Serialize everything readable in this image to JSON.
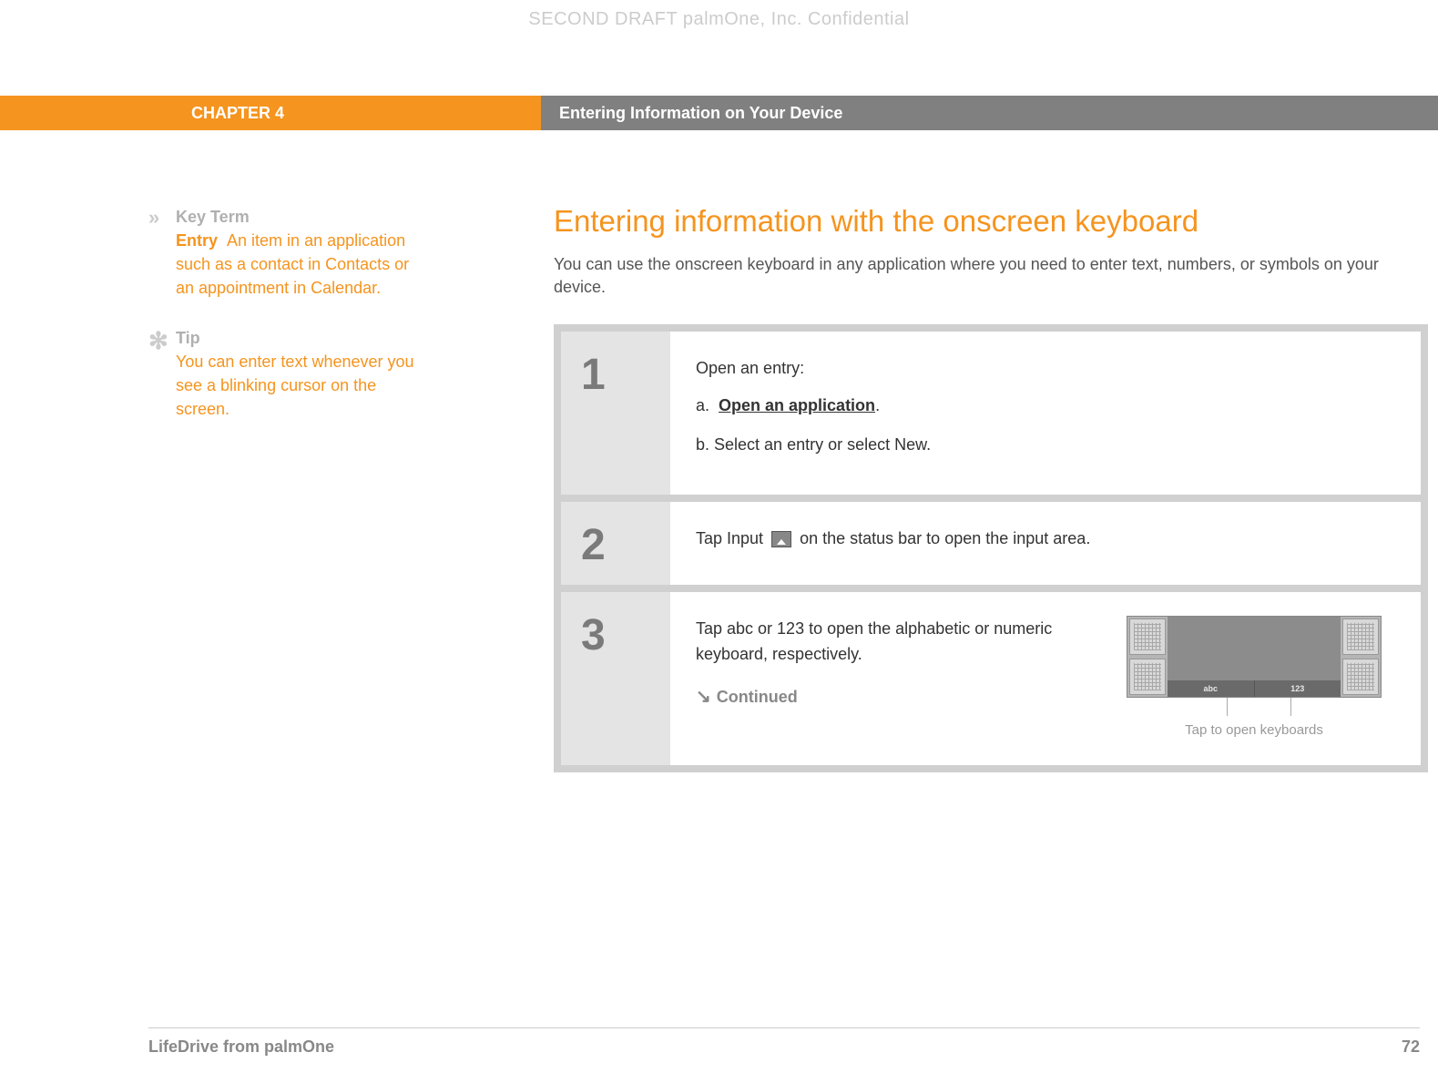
{
  "watermark": "SECOND DRAFT palmOne, Inc.  Confidential",
  "header": {
    "chapter": "CHAPTER 4",
    "section": "Entering Information on Your Device"
  },
  "sidebar": {
    "keyterm": {
      "heading": "Key Term",
      "term": "Entry",
      "definition": "An item in an application such as a contact in Contacts or an appointment in Calendar."
    },
    "tip": {
      "heading": "Tip",
      "text": "You can enter text whenever you see a blinking cursor on the screen."
    }
  },
  "main": {
    "title": "Entering information with the onscreen keyboard",
    "intro": "You can use the onscreen keyboard in any application where you need to enter text, numbers, or symbols on your device."
  },
  "steps": [
    {
      "num": "1",
      "lead": "Open an entry:",
      "sub_a_prefix": "a.",
      "sub_a_link": "Open an application",
      "sub_a_suffix": ".",
      "sub_b": "b.  Select an entry or select New."
    },
    {
      "num": "2",
      "text_before": "Tap Input",
      "text_after": "on the status bar to open the input area."
    },
    {
      "num": "3",
      "text": "Tap abc or 123 to open the alphabetic or numeric keyboard, respectively.",
      "continued": "Continued",
      "tab_abc": "abc",
      "tab_123": "123",
      "caption": "Tap to open keyboards"
    }
  ],
  "footer": {
    "product": "LifeDrive from palmOne",
    "page": "72"
  }
}
